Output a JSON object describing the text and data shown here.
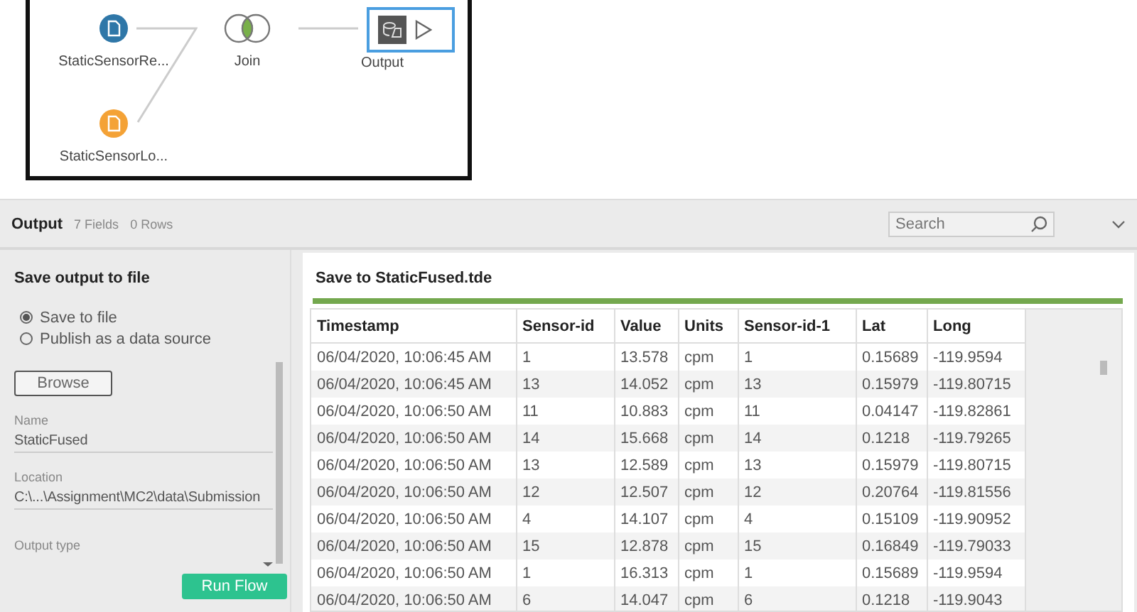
{
  "flow": {
    "nodes": [
      {
        "kind": "input",
        "label": "StaticSensorRe...",
        "color": "#2f77a8"
      },
      {
        "kind": "input",
        "label": "StaticSensorLo...",
        "color": "#f4a236"
      },
      {
        "kind": "join",
        "label": "Join"
      },
      {
        "kind": "output",
        "label": "Output",
        "selected": true
      }
    ]
  },
  "header": {
    "title": "Output",
    "fields": "7 Fields",
    "rows": "0 Rows",
    "search": {
      "placeholder": "Search"
    }
  },
  "settings": {
    "title": "Save output to file",
    "options": [
      {
        "label": "Save to file",
        "selected": true
      },
      {
        "label": "Publish as a data source",
        "selected": false
      }
    ],
    "browse": "Browse",
    "fields": [
      {
        "label": "Name",
        "value": "StaticFused"
      },
      {
        "label": "Location",
        "value": "C:\\...\\Assignment\\MC2\\data\\Submission"
      },
      {
        "label": "Output type"
      }
    ],
    "run": "Run Flow"
  },
  "preview": {
    "title": "Save to StaticFused.tde",
    "progress": {
      "level": 1
    },
    "table": {
      "columns": [
        "Timestamp",
        "Sensor-id",
        "Value",
        "Units",
        "Sensor-id-1",
        "Lat",
        "Long"
      ],
      "rows": [
        [
          "06/04/2020, 10:06:45 AM",
          "1",
          "13.578",
          "cpm",
          "1",
          "0.15689",
          "-119.9594"
        ],
        [
          "06/04/2020, 10:06:45 AM",
          "13",
          "14.052",
          "cpm",
          "13",
          "0.15979",
          "-119.80715"
        ],
        [
          "06/04/2020, 10:06:50 AM",
          "11",
          "10.883",
          "cpm",
          "11",
          "0.04147",
          "-119.82861"
        ],
        [
          "06/04/2020, 10:06:50 AM",
          "14",
          "15.668",
          "cpm",
          "14",
          "0.1218",
          "-119.79265"
        ],
        [
          "06/04/2020, 10:06:50 AM",
          "13",
          "12.589",
          "cpm",
          "13",
          "0.15979",
          "-119.80715"
        ],
        [
          "06/04/2020, 10:06:50 AM",
          "12",
          "12.507",
          "cpm",
          "12",
          "0.20764",
          "-119.81556"
        ],
        [
          "06/04/2020, 10:06:50 AM",
          "4",
          "14.107",
          "cpm",
          "4",
          "0.15109",
          "-119.90952"
        ],
        [
          "06/04/2020, 10:06:50 AM",
          "15",
          "12.878",
          "cpm",
          "15",
          "0.16849",
          "-119.79033"
        ],
        [
          "06/04/2020, 10:06:50 AM",
          "1",
          "16.313",
          "cpm",
          "1",
          "0.15689",
          "-119.9594"
        ],
        [
          "06/04/2020, 10:06:50 AM",
          "6",
          "14.047",
          "cpm",
          "6",
          "0.1218",
          "-119.9043"
        ]
      ]
    }
  }
}
